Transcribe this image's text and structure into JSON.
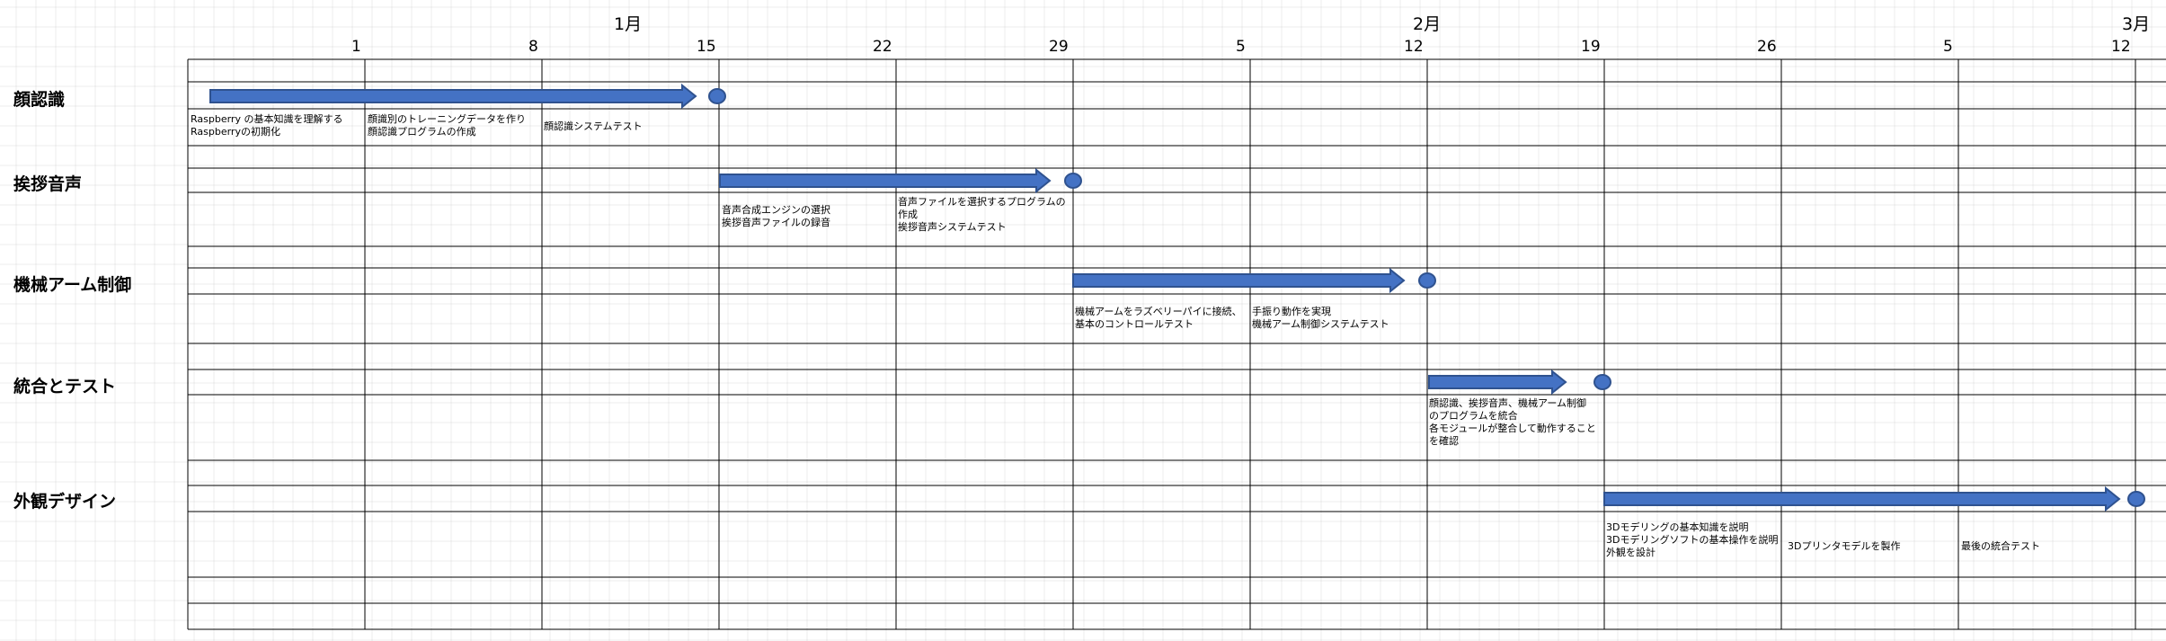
{
  "months": [
    {
      "label": "1月"
    },
    {
      "label": "2月"
    },
    {
      "label": "3月"
    }
  ],
  "days": [
    "1",
    "8",
    "15",
    "22",
    "29",
    "5",
    "12",
    "19",
    "26",
    "5",
    "12"
  ],
  "tasks": [
    {
      "name": "顔認識"
    },
    {
      "name": "挨拶音声"
    },
    {
      "name": "機械アーム制御"
    },
    {
      "name": "統合とテスト"
    },
    {
      "name": "外観デザイン"
    }
  ],
  "notes": [
    {
      "lines": [
        "Raspberry の基本知識を理解する",
        "Raspberryの初期化"
      ]
    },
    {
      "lines": [
        "顔識別のトレーニングデータを作り",
        "顔認識プログラムの作成"
      ]
    },
    {
      "lines": [
        "顔認識システムテスト"
      ]
    },
    {
      "lines": [
        "音声合成エンジンの選択",
        "挨拶音声ファイルの録音"
      ]
    },
    {
      "lines": [
        "音声ファイルを選択するプログラムの",
        "作成",
        "挨拶音声システムテスト"
      ]
    },
    {
      "lines": [
        "機械アームをラズベリーパイに接続、",
        "基本のコントロールテスト"
      ]
    },
    {
      "lines": [
        "手振り動作を実現",
        "機械アーム制御システムテスト"
      ]
    },
    {
      "lines": [
        "顔認識、挨拶音声、機械アーム制御",
        "のプログラムを統合",
        "各モジュールが整合して動作すること",
        "を確認"
      ]
    },
    {
      "lines": [
        "3Dモデリングの基本知識を説明",
        "3Dモデリングソフトの基本操作を説明",
        "外観を設計"
      ]
    },
    {
      "lines": [
        "3Dプリンタモデルを製作"
      ]
    },
    {
      "lines": [
        "最後の統合テスト"
      ]
    }
  ],
  "colors": {
    "arrow_fill": "#4472c4",
    "arrow_stroke": "#2f528f",
    "grid": "#000000",
    "bg_grid": "#d9d9d9"
  }
}
